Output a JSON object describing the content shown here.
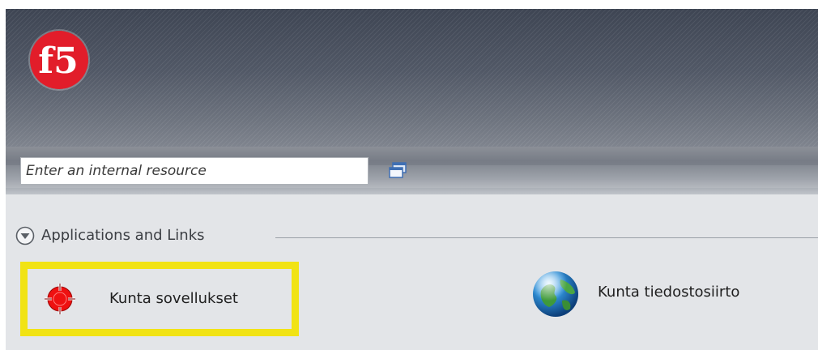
{
  "brand": {
    "logo_text": "f5",
    "logo_color": "#e21d2a"
  },
  "toolbar": {
    "resource_placeholder": "Enter an internal resource",
    "windows_icon": "windows-icon"
  },
  "section": {
    "title": "Applications and Links",
    "collapse_icon": "chevron-down-circle-icon"
  },
  "apps": [
    {
      "label": "Kunta sovellukset",
      "icon": "target-icon",
      "highlighted": true,
      "highlight_color": "#f1e314"
    },
    {
      "label": "Kunta tiedostosiirto",
      "icon": "globe-icon",
      "highlighted": false
    }
  ]
}
